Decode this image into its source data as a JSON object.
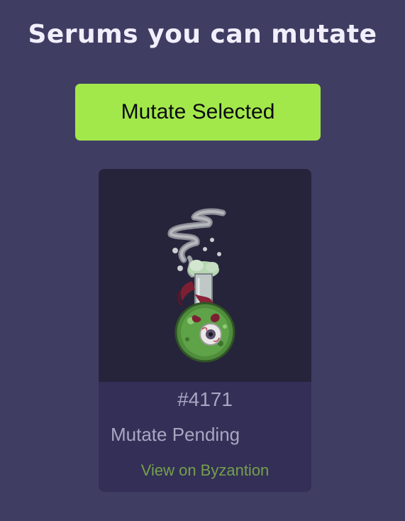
{
  "page": {
    "title": "Serums you can mutate"
  },
  "actions": {
    "mutate_selected_label": "Mutate Selected"
  },
  "cards": [
    {
      "token_id": "#4171",
      "status": "Mutate Pending",
      "link_label": "View on Byzantion",
      "image_icon": "serum-bottle-eyeball-icon"
    }
  ],
  "colors": {
    "background": "#403d63",
    "button": "#a3e84b",
    "card": "#332f56",
    "card_image_bg": "#26243b",
    "link": "#74a04d",
    "muted_text": "#a9a6c2"
  }
}
